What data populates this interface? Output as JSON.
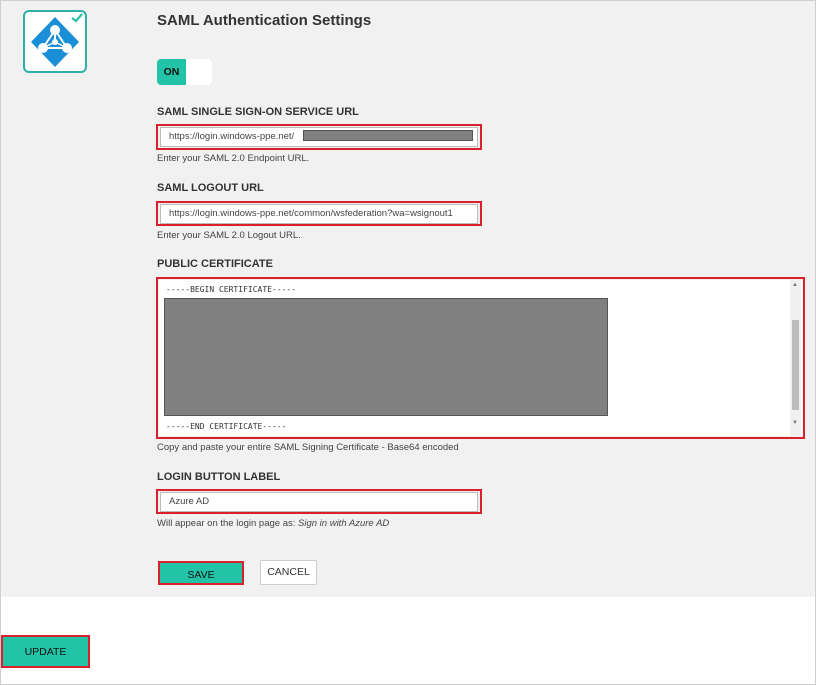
{
  "header": {
    "title": "SAML Authentication Settings"
  },
  "toggle": {
    "state": "ON"
  },
  "sso_url": {
    "label": "SAML SINGLE SIGN-ON SERVICE URL",
    "value": "https://login.windows-ppe.net/",
    "help": "Enter your SAML 2.0 Endpoint URL."
  },
  "logout_url": {
    "label": "SAML LOGOUT URL",
    "value": "https://login.windows-ppe.net/common/wsfederation?wa=wsignout1",
    "help": "Enter your SAML 2.0 Logout URL."
  },
  "certificate": {
    "label": "PUBLIC CERTIFICATE",
    "begin": "-----BEGIN CERTIFICATE-----",
    "end": "-----END CERTIFICATE-----",
    "help": "Copy and paste your entire SAML Signing Certificate - Base64 encoded"
  },
  "login_button": {
    "label": "LOGIN BUTTON LABEL",
    "value": "Azure AD",
    "help_prefix": "Will appear on the login page as: ",
    "help_example": "Sign in with Azure AD"
  },
  "actions": {
    "save": "SAVE",
    "cancel": "CANCEL",
    "update": "UPDATE"
  },
  "colors": {
    "accent": "#22c3a6",
    "highlight": "#d9202c",
    "logo_blue": "#1a8fd8",
    "redaction": "#808080"
  },
  "icons": {
    "logo": "azure-ad-logo-icon",
    "check": "checkmark-icon"
  }
}
